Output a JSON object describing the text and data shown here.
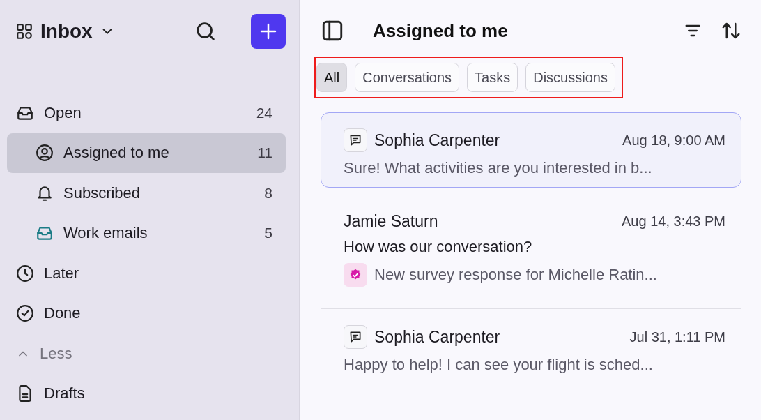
{
  "sidebar": {
    "title": "Inbox",
    "items": [
      {
        "kind": "link",
        "label": "Open",
        "count": "24",
        "selected": false,
        "children": [
          {
            "kind": "link",
            "label": "Assigned to me",
            "count": "11",
            "selected": true
          },
          {
            "kind": "link",
            "label": "Subscribed",
            "count": "8",
            "selected": false
          },
          {
            "kind": "link",
            "label": "Work emails",
            "count": "5",
            "color": "#1b7c86",
            "selected": false
          }
        ]
      },
      {
        "kind": "link",
        "label": "Later",
        "selected": false
      },
      {
        "kind": "link",
        "label": "Done",
        "selected": false
      },
      {
        "kind": "toggle",
        "label": "Less",
        "selected": false
      },
      {
        "kind": "link",
        "label": "Drafts",
        "selected": false
      }
    ]
  },
  "header": {
    "title": "Assigned to me"
  },
  "filters": [
    {
      "label": "All",
      "selected": true
    },
    {
      "label": "Conversations",
      "selected": false
    },
    {
      "label": "Tasks",
      "selected": false
    },
    {
      "label": "Discussions",
      "selected": false
    }
  ],
  "messages": [
    {
      "kind": "conversation",
      "name": "Sophia Carpenter",
      "date": "Aug 18, 9:00 AM",
      "preview": "Sure! What activities are you interested in b...",
      "selected": true
    },
    {
      "kind": "survey",
      "name": "Jamie Saturn",
      "date": "Aug 14, 3:43 PM",
      "subject": "How was our conversation?",
      "preview": "New survey response for Michelle Ratin...",
      "selected": false
    },
    {
      "kind": "conversation",
      "name": "Sophia Carpenter",
      "date": "Jul 31, 1:11 PM",
      "preview": "Happy to help! I can see your flight is sched...",
      "selected": false
    }
  ]
}
